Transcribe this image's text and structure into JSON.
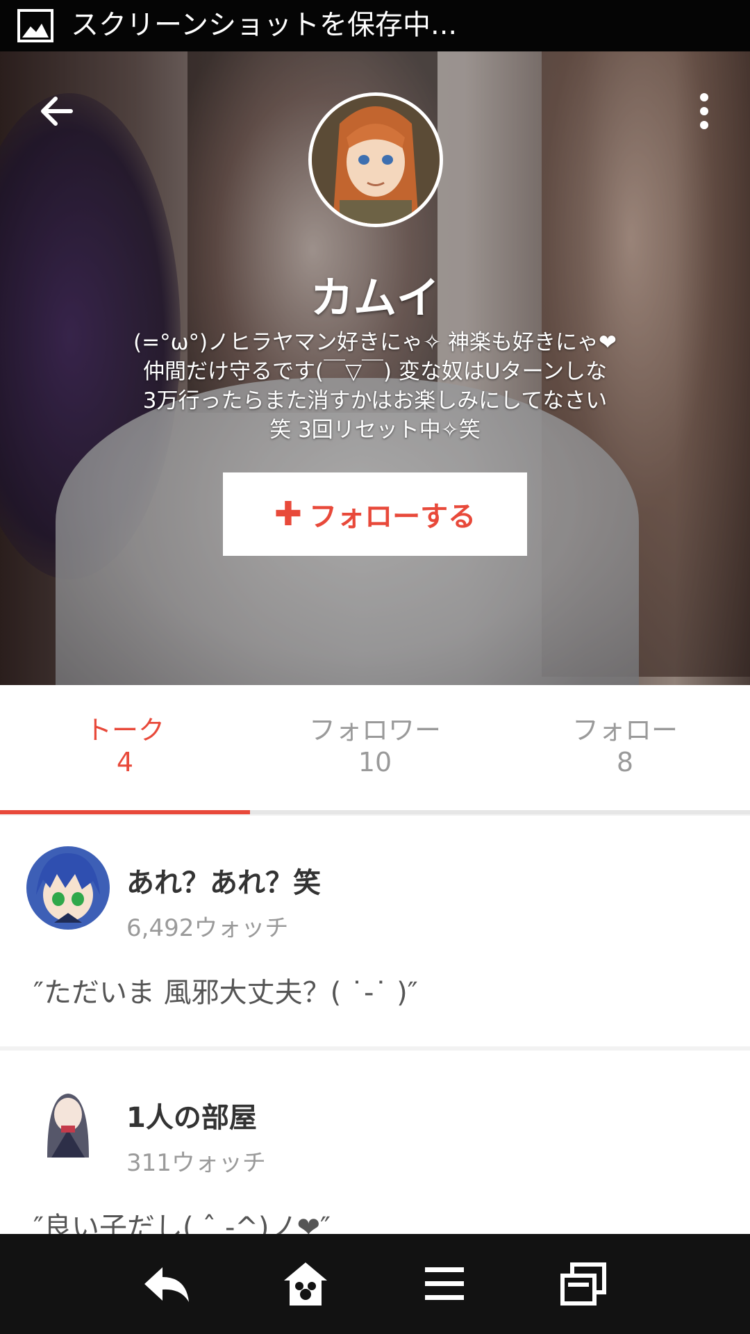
{
  "status_bar": {
    "text": "スクリーンショットを保存中..."
  },
  "profile": {
    "name": "カムイ",
    "bio_lines": [
      "(=°ω°)ノヒラヤマン好きにゃ✧ 神楽も好きにゃ❤",
      "仲間だけ守るです(￣▽￣) 変な奴はUターンしな",
      "3万行ったらまた消すかはお楽しみにしてなさい",
      "笑 3回リセット中✧笑"
    ],
    "follow_label": "フォローする",
    "follow_icon": "plus-icon"
  },
  "tabs": [
    {
      "label": "トーク",
      "count": "4"
    },
    {
      "label": "フォロワー",
      "count": "10"
    },
    {
      "label": "フォロー",
      "count": "8"
    }
  ],
  "talks": [
    {
      "title": "あれ？あれ？笑",
      "watch": "6,492ウォッチ",
      "quote": "″ただいま 風邪大丈夫？( ˙-˙ )″"
    },
    {
      "title": "1人の部屋",
      "watch": "311ウォッチ",
      "quote": "″良い子だし( ˆ -^)ノ❤″"
    }
  ],
  "colors": {
    "accent": "#e8493a",
    "navbar": "#121212",
    "statusbar": "#050505"
  },
  "icons": [
    "image-icon",
    "back-arrow-icon",
    "overflow-menu-icon",
    "nav-back-icon",
    "nav-home-icon",
    "nav-menu-icon",
    "nav-recents-icon"
  ]
}
